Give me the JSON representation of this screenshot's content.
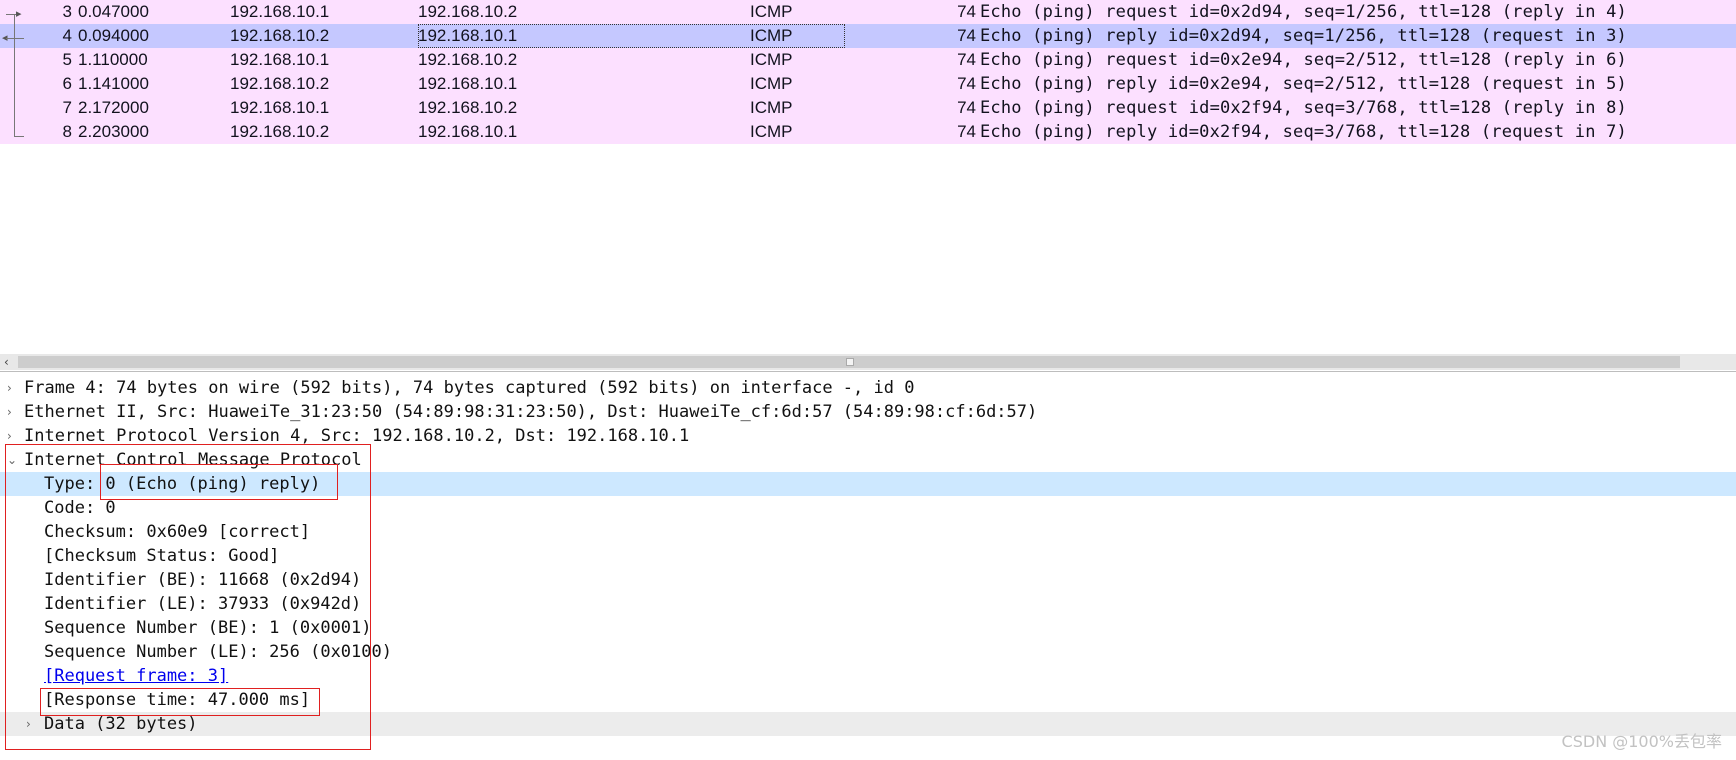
{
  "packets": [
    {
      "no": "3",
      "time": "0.047000",
      "src": "192.168.10.1",
      "dst": "192.168.10.2",
      "proto": "ICMP",
      "len": "74",
      "info": "Echo (ping) request  id=0x2d94, seq=1/256, ttl=128 (reply in 4)"
    },
    {
      "no": "4",
      "time": "0.094000",
      "src": "192.168.10.2",
      "dst": "192.168.10.1",
      "proto": "ICMP",
      "len": "74",
      "info": "Echo (ping) reply    id=0x2d94, seq=1/256, ttl=128 (request in 3)"
    },
    {
      "no": "5",
      "time": "1.110000",
      "src": "192.168.10.1",
      "dst": "192.168.10.2",
      "proto": "ICMP",
      "len": "74",
      "info": "Echo (ping) request  id=0x2e94, seq=2/512, ttl=128 (reply in 6)"
    },
    {
      "no": "6",
      "time": "1.141000",
      "src": "192.168.10.2",
      "dst": "192.168.10.1",
      "proto": "ICMP",
      "len": "74",
      "info": "Echo (ping) reply    id=0x2e94, seq=2/512, ttl=128 (request in 5)"
    },
    {
      "no": "7",
      "time": "2.172000",
      "src": "192.168.10.1",
      "dst": "192.168.10.2",
      "proto": "ICMP",
      "len": "74",
      "info": "Echo (ping) request  id=0x2f94, seq=3/768, ttl=128 (reply in 8)"
    },
    {
      "no": "8",
      "time": "2.203000",
      "src": "192.168.10.2",
      "dst": "192.168.10.1",
      "proto": "ICMP",
      "len": "74",
      "info": "Echo (ping) reply    id=0x2f94, seq=3/768, ttl=128 (request in 7)"
    }
  ],
  "selected_packet": "4",
  "details": {
    "frame": "Frame 4: 74 bytes on wire (592 bits), 74 bytes captured (592 bits) on interface -, id 0",
    "ethernet": "Ethernet II, Src: HuaweiTe_31:23:50 (54:89:98:31:23:50), Dst: HuaweiTe_cf:6d:57 (54:89:98:cf:6d:57)",
    "ip": "Internet Protocol Version 4, Src: 192.168.10.2, Dst: 192.168.10.1",
    "icmp": "Internet Control Message Protocol",
    "icmp_fields": {
      "type": "Type: 0 (Echo (ping) reply)",
      "code": "Code: 0",
      "checksum": "Checksum: 0x60e9 [correct]",
      "checksum_status": "[Checksum Status: Good]",
      "identifier_be": "Identifier (BE): 11668 (0x2d94)",
      "identifier_le": "Identifier (LE): 37933 (0x942d)",
      "sequence_be": "Sequence Number (BE): 1 (0x0001)",
      "sequence_le": "Sequence Number (LE): 256 (0x0100)",
      "request_frame": "[Request frame: 3]",
      "response_time": "[Response time: 47.000 ms]",
      "data": "Data (32 bytes)"
    }
  },
  "icons": {
    "collapsed": "chevron-right-icon",
    "expanded": "chevron-down-icon",
    "scroll_left": "scroll-left-arrow-icon"
  },
  "colors": {
    "icmp_row": "#fce0ff",
    "selected_row": "#c5c8ff",
    "selected_detail": "#cde8ff",
    "annotation": "#e02020"
  },
  "watermark": "CSDN @100%丢包率"
}
